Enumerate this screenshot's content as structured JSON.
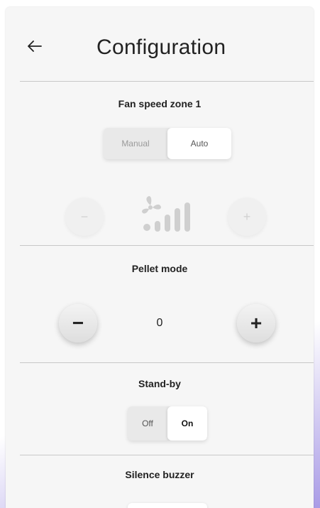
{
  "header": {
    "title": "Configuration"
  },
  "fan": {
    "title": "Fan speed zone 1",
    "mode_options": [
      "Manual",
      "Auto"
    ],
    "selected_mode": "Auto",
    "minus_label": "−",
    "plus_label": "+"
  },
  "pellet": {
    "title": "Pellet mode",
    "value": "0",
    "minus_label": "−",
    "plus_label": "+"
  },
  "standby": {
    "title": "Stand-by",
    "options": [
      "Off",
      "On"
    ],
    "selected": "On"
  },
  "silence": {
    "title": "Silence buzzer"
  },
  "colors": {
    "panel_bg": "#f6f6f6",
    "accent_purple": "#a99be6",
    "disabled_icon": "#cfcfcf"
  },
  "icons": [
    "back-arrow-icon",
    "fan-speed-icon",
    "minus-icon",
    "plus-icon"
  ]
}
